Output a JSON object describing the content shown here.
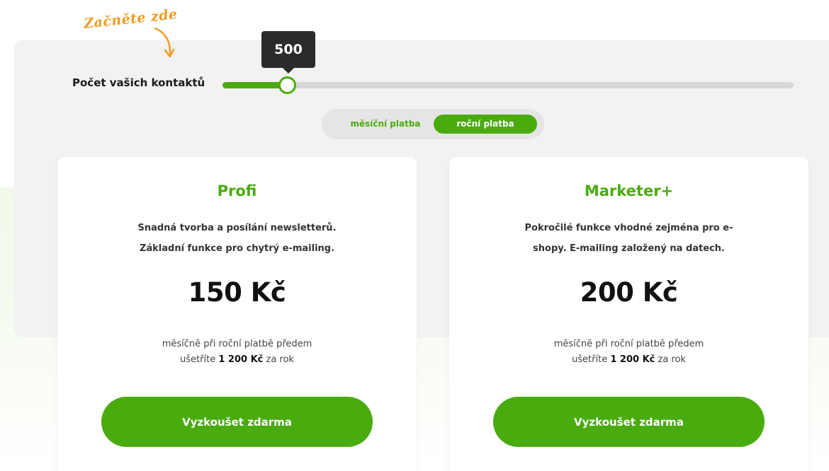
{
  "hint": {
    "text": "Začněte zde"
  },
  "slider": {
    "label": "Počet vašich kontaktů",
    "value": "500",
    "fill_fraction": 0.11
  },
  "billing_toggle": {
    "monthly_label": "měsíční platba",
    "yearly_label": "roční platba",
    "selected": "yearly"
  },
  "plans": [
    {
      "name": "Profi",
      "description_line1": "Snadná tvorba a posílání newsletterů.",
      "description_line2": "Základní funkce pro chytrý e-mailing.",
      "price": "150 Kč",
      "note_line1": "měsíčně při roční platbě předem",
      "note_prefix": "ušetříte",
      "note_amount": "1 200 Kč",
      "note_suffix": "za rok",
      "button_label": "Vyzkoušet zdarma"
    },
    {
      "name": "Marketer+",
      "description_line1": "Pokročilé funkce vhodné zejména pro e-",
      "description_line2": "shopy. E-mailing založený na datech.",
      "price": "200 Kč",
      "note_line1": "měsíčně při roční platbě předem",
      "note_prefix": "ušetříte",
      "note_amount": "1 200 Kč",
      "note_suffix": "za rok",
      "button_label": "Vyzkoušet zdarma"
    }
  ],
  "colors": {
    "accent": "#4aab0f",
    "hint": "#f39a1e",
    "tooltip_bg": "#2b2b2b",
    "panel_bg": "#f2f2f2"
  },
  "icons": {
    "hint_arrow": "curved-arrow-icon"
  }
}
